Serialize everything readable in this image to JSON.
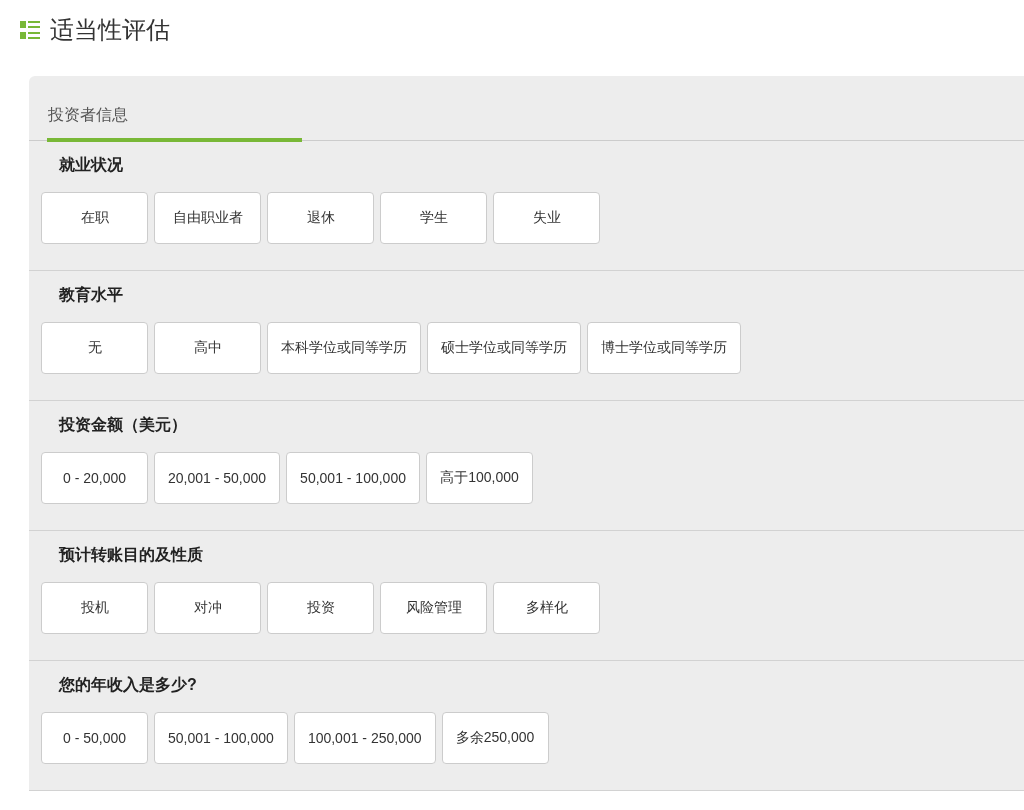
{
  "page": {
    "title": "适当性评估"
  },
  "tabs": [
    {
      "label": "投资者信息",
      "selected": true
    }
  ],
  "sections": [
    {
      "heading": "就业状况",
      "options": [
        {
          "label": "在职",
          "selected": false
        },
        {
          "label": "自由职业者",
          "selected": false
        },
        {
          "label": "退休",
          "selected": false
        },
        {
          "label": "学生",
          "selected": false
        },
        {
          "label": "失业",
          "selected": false
        }
      ]
    },
    {
      "heading": "教育水平",
      "options": [
        {
          "label": "无",
          "selected": false
        },
        {
          "label": "高中",
          "selected": false
        },
        {
          "label": "本科学位或同等学历",
          "selected": false
        },
        {
          "label": "硕士学位或同等学历",
          "selected": false
        },
        {
          "label": "博士学位或同等学历",
          "selected": false
        }
      ]
    },
    {
      "heading": "投资金额（美元）",
      "options": [
        {
          "label": "0 - 20,000",
          "selected": false
        },
        {
          "label": "20,001 - 50,000",
          "selected": false
        },
        {
          "label": "50,001 - 100,000",
          "selected": false
        },
        {
          "label": "高于100,000",
          "selected": false
        }
      ]
    },
    {
      "heading": "预计转账目的及性质",
      "options": [
        {
          "label": "投机",
          "selected": false
        },
        {
          "label": "对冲",
          "selected": false
        },
        {
          "label": "投资",
          "selected": false
        },
        {
          "label": "风险管理",
          "selected": false
        },
        {
          "label": "多样化",
          "selected": false
        }
      ]
    },
    {
      "heading": "您的年收入是多少?",
      "options": [
        {
          "label": "0 - 50,000",
          "selected": false
        },
        {
          "label": "50,001 - 100,000",
          "selected": false
        },
        {
          "label": "100,001 - 250,000",
          "selected": false
        },
        {
          "label": "多余250,000",
          "selected": false
        }
      ]
    }
  ]
}
